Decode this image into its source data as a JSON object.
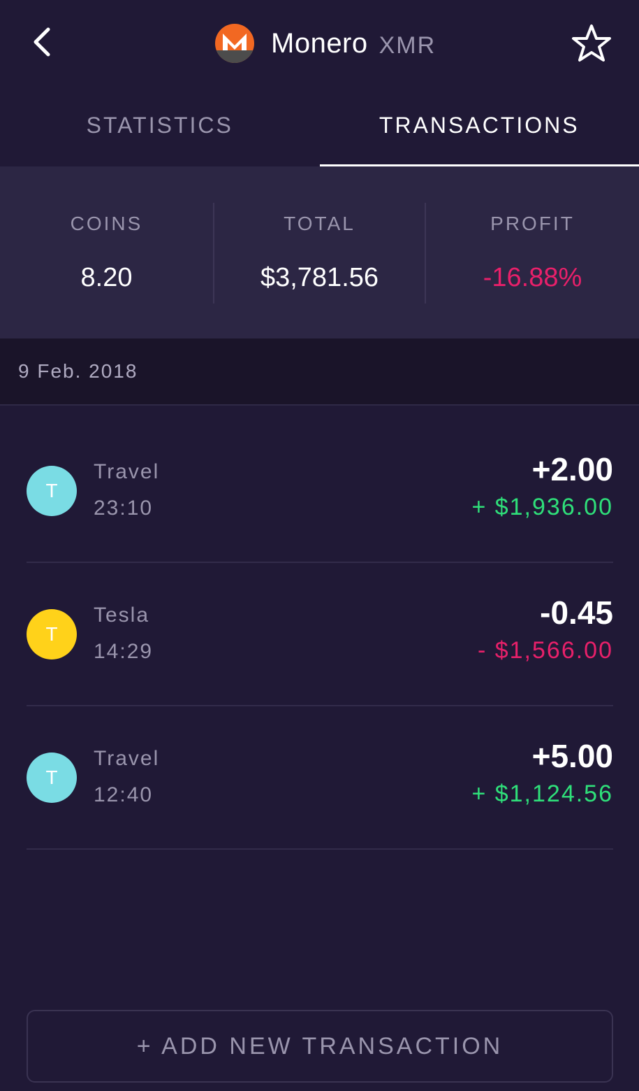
{
  "header": {
    "coin_name": "Monero",
    "coin_symbol": "XMR"
  },
  "tabs": [
    {
      "label": "STATISTICS",
      "active": false
    },
    {
      "label": "TRANSACTIONS",
      "active": true
    }
  ],
  "summary": {
    "coins": {
      "label": "COINS",
      "value": "8.20"
    },
    "total": {
      "label": "TOTAL",
      "value": "$3,781.56"
    },
    "profit": {
      "label": "PROFIT",
      "value": "-16.88%"
    }
  },
  "date_group": "9 Feb. 2018",
  "transactions": [
    {
      "initial": "T",
      "name": "Travel",
      "time": "23:10",
      "amount": "+2.00",
      "value": "+ $1,936.00",
      "avatar_color": "#7adce4",
      "direction": "positive"
    },
    {
      "initial": "T",
      "name": "Tesla",
      "time": "14:29",
      "amount": "-0.45",
      "value": "- $1,566.00",
      "avatar_color": "#ffd21a",
      "direction": "negative"
    },
    {
      "initial": "T",
      "name": "Travel",
      "time": "12:40",
      "amount": "+5.00",
      "value": "+ $1,124.56",
      "avatar_color": "#7adce4",
      "direction": "positive"
    }
  ],
  "add_button": "+ ADD NEW TRANSACTION",
  "colors": {
    "background": "#201936",
    "summary_bg": "#2c2644",
    "positive": "#2fe07a",
    "negative": "#e8206a",
    "monero_orange": "#f26822"
  },
  "icons": {
    "back": "chevron-left-icon",
    "star": "star-outline-icon",
    "logo": "monero-logo-icon"
  }
}
